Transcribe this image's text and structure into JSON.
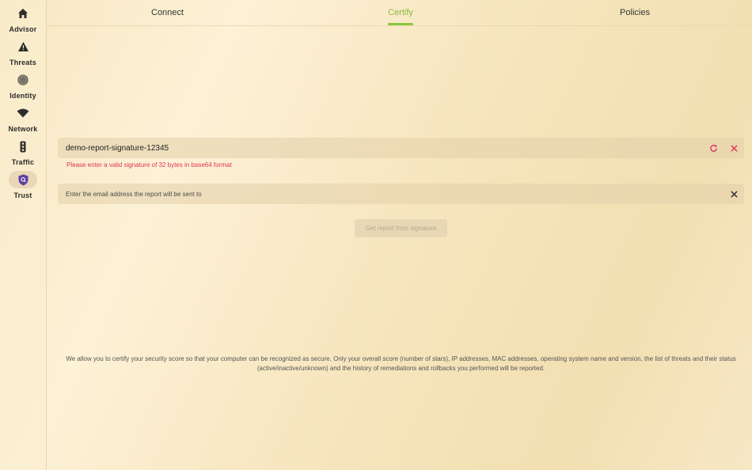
{
  "sidebar": {
    "items": [
      {
        "label": "Advisor",
        "icon": "home-icon"
      },
      {
        "label": "Threats",
        "icon": "warning-icon"
      },
      {
        "label": "Identity",
        "icon": "fingerprint-icon"
      },
      {
        "label": "Network",
        "icon": "wifi-icon"
      },
      {
        "label": "Traffic",
        "icon": "traffic-light-icon"
      },
      {
        "label": "Trust",
        "icon": "shield-search-icon",
        "active": true
      }
    ]
  },
  "tabs": [
    {
      "label": "Connect"
    },
    {
      "label": "Certify",
      "active": true
    },
    {
      "label": "Policies"
    }
  ],
  "signature": {
    "value": "demo-report-signature-12345",
    "error": "Please enter a valid signature of 32 bytes in base64 format"
  },
  "email": {
    "value": "",
    "placeholder": "Enter the email address the report will be sent to"
  },
  "submit_label": "Get report from signature",
  "footnote": "We allow you to certify your security score so that your computer can be recognized as secure. Only your overall score (number of stars), IP addresses, MAC addresses, operating system name and version, the list of threats and their status (active/inactive/unknown) and the history of remediations and rollbacks you performed will be reported.",
  "colors": {
    "accent": "#8cc63e",
    "error": "#e0345a",
    "trust_icon": "#5a3fa0"
  }
}
